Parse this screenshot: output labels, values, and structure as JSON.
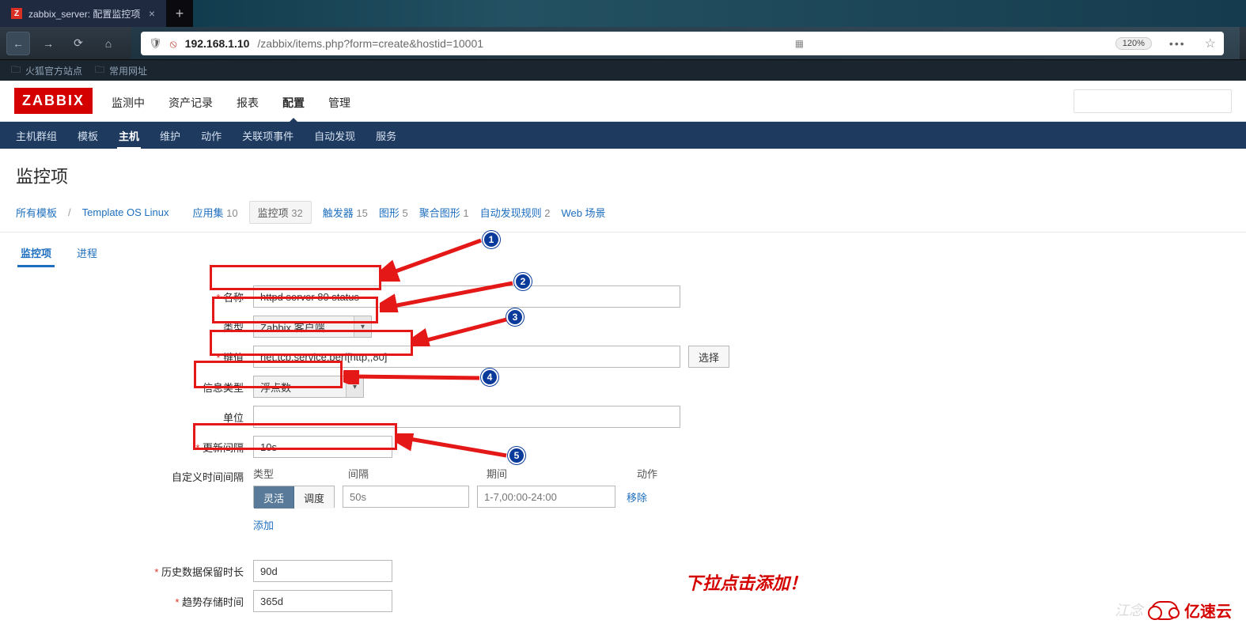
{
  "browser": {
    "tab_title": "zabbix_server: 配置监控项",
    "bookmarks": [
      "火狐官方站点",
      "常用网址"
    ],
    "url_host": "192.168.1.10",
    "url_path": "/zabbix/items.php?form=create&hostid=10001",
    "zoom": "120%"
  },
  "zabbix": {
    "logo": "ZABBIX",
    "menu": [
      "监测中",
      "资产记录",
      "报表",
      "配置",
      "管理"
    ],
    "menu_active_index": 3,
    "submenu": [
      "主机群组",
      "模板",
      "主机",
      "维护",
      "动作",
      "关联项事件",
      "自动发现",
      "服务"
    ],
    "submenu_active_index": 2
  },
  "page": {
    "title": "监控项",
    "breadcrumb": {
      "all_templates": "所有模板",
      "template": "Template OS Linux"
    },
    "navtabs": [
      {
        "label": "应用集",
        "count": "10"
      },
      {
        "label": "监控项",
        "count": "32"
      },
      {
        "label": "触发器",
        "count": "15"
      },
      {
        "label": "图形",
        "count": "5"
      },
      {
        "label": "聚合图形",
        "count": "1"
      },
      {
        "label": "自动发现规则",
        "count": "2"
      },
      {
        "label": "Web 场景",
        "count": ""
      }
    ],
    "navtabs_active_index": 1,
    "formtabs": [
      "监控项",
      "进程"
    ],
    "formtabs_active_index": 0
  },
  "form": {
    "name_label": "名称",
    "name_value": "httpd server 80 status",
    "type_label": "类型",
    "type_value": "Zabbix 客户端",
    "key_label": "键值",
    "key_value": "net.tcp.service.perf[http,,80]",
    "key_select_btn": "选择",
    "info_type_label": "信息类型",
    "info_type_value": "浮点数",
    "unit_label": "单位",
    "unit_value": "",
    "update_label": "更新间隔",
    "update_value": "10s",
    "custom_interval_label": "自定义时间间隔",
    "ci_headers": {
      "type": "类型",
      "interval": "间隔",
      "period": "期间",
      "action": "动作"
    },
    "ci_flex_btn": "灵活",
    "ci_sched_btn": "调度",
    "ci_interval_placeholder": "50s",
    "ci_period_placeholder": "1-7,00:00-24:00",
    "ci_remove": "移除",
    "ci_add": "添加",
    "history_label": "历史数据保留时长",
    "history_value": "90d",
    "trend_label": "趋势存储时间",
    "trend_value": "365d"
  },
  "annotations": {
    "markers": [
      "1",
      "2",
      "3",
      "4",
      "5"
    ],
    "hint_text": "下拉点击添加！",
    "watermark": "亿速云",
    "faint": "江念"
  }
}
